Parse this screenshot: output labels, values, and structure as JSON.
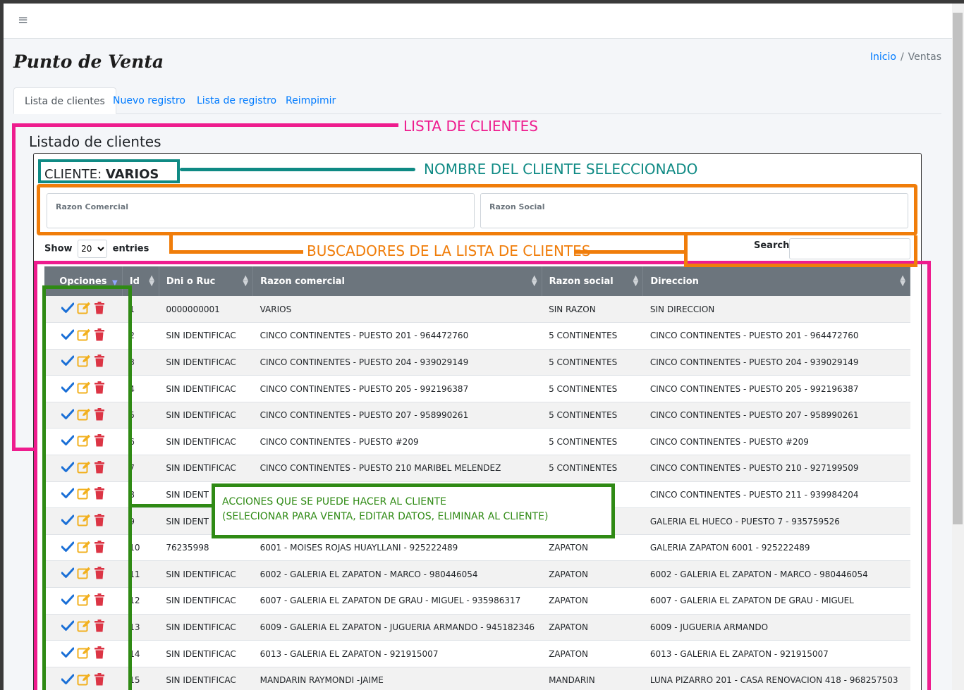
{
  "header": {
    "menu_icon": "hamburger-icon",
    "menu_glyph": "≡"
  },
  "page": {
    "title": "Punto de Venta"
  },
  "breadcrumb": {
    "home": "Inicio",
    "separator": "/",
    "current": "Ventas"
  },
  "tabs": [
    {
      "label": "Lista de clientes"
    },
    {
      "label": "Nuevo registro"
    },
    {
      "label": "Lista de registro"
    },
    {
      "label": "Reimpimir"
    }
  ],
  "section": {
    "title": "Listado de clientes"
  },
  "client": {
    "prefix": "CLIENTE:",
    "name": "VARIOS"
  },
  "filters": {
    "razon_comercial": "Razon Comercial",
    "razon_social": "Razon Social"
  },
  "length": {
    "show": "Show",
    "value": "20",
    "entries": "entries"
  },
  "search": {
    "label": "Search:"
  },
  "table": {
    "headers": [
      "Opciones",
      "Id",
      "Dni o Ruc",
      "Razon comercial",
      "Razon social",
      "Direccion"
    ],
    "rows": [
      [
        "1",
        "0000000001",
        "VARIOS",
        "SIN RAZON",
        "SIN DIRECCION"
      ],
      [
        "2",
        "SIN IDENTIFICAC",
        "CINCO CONTINENTES - PUESTO 201 - 964472760",
        "5 CONTINENTES",
        "CINCO CONTINENTES - PUESTO 201 - 964472760"
      ],
      [
        "3",
        "SIN IDENTIFICAC",
        "CINCO CONTINENTES - PUESTO 204 - 939029149",
        "5 CONTINENTES",
        "CINCO CONTINENTES - PUESTO 204 - 939029149"
      ],
      [
        "4",
        "SIN IDENTIFICAC",
        "CINCO CONTINENTES - PUESTO 205 - 992196387",
        "5 CONTINENTES",
        "CINCO CONTINENTES - PUESTO 205 - 992196387"
      ],
      [
        "5",
        "SIN IDENTIFICAC",
        "CINCO CONTINENTES - PUESTO 207 - 958990261",
        "5 CONTINENTES",
        "CINCO CONTINENTES - PUESTO 207 - 958990261"
      ],
      [
        "6",
        "SIN IDENTIFICAC",
        "CINCO CONTINENTES - PUESTO #209",
        "5 CONTINENTES",
        "CINCO CONTINENTES - PUESTO #209"
      ],
      [
        "7",
        "SIN IDENTIFICAC",
        "CINCO CONTINENTES - PUESTO 210 MARIBEL MELENDEZ",
        "5 CONTINENTES",
        "CINCO CONTINENTES - PUESTO 210 - 927199509"
      ],
      [
        "8",
        "SIN IDENT",
        "",
        "",
        "CINCO CONTINENTES - PUESTO 211 - 939984204"
      ],
      [
        "9",
        "SIN IDENT",
        "",
        "",
        "GALERIA EL HUECO - PUESTO 7 - 935759526"
      ],
      [
        "10",
        "76235998",
        "6001 - MOISES ROJAS HUAYLLANI - 925222489",
        "ZAPATON",
        "GALERIA ZAPATON 6001 - 925222489"
      ],
      [
        "11",
        "SIN IDENTIFICAC",
        "6002 - GALERIA EL ZAPATON - MARCO - 980446054",
        "ZAPATON",
        "6002 - GALERIA EL ZAPATON - MARCO - 980446054"
      ],
      [
        "12",
        "SIN IDENTIFICAC",
        "6007 - GALERIA EL ZAPATON DE GRAU - MIGUEL - 935986317",
        "ZAPATON",
        "6007 - GALERIA EL ZAPATON DE GRAU - MIGUEL"
      ],
      [
        "13",
        "SIN IDENTIFICAC",
        "6009 - GALERIA EL ZAPATON - JUGUERIA ARMANDO - 945182346",
        "ZAPATON",
        "6009 - JUGUERIA ARMANDO"
      ],
      [
        "14",
        "SIN IDENTIFICAC",
        "6013 - GALERIA EL ZAPATON - 921915007",
        "ZAPATON",
        "6013 - GALERIA EL ZAPATON - 921915007"
      ],
      [
        "15",
        "SIN IDENTIFICAC",
        "MANDARIN RAYMONDI -JAIME",
        "MANDARIN",
        "LUNA PIZARRO 201 - CASA RENOVACION 418 - 968257503"
      ]
    ],
    "row_icons": [
      "check-icon",
      "edit-icon",
      "trash-icon"
    ]
  },
  "annotations": {
    "lista": "LISTA DE CLIENTES",
    "nombre": "NOMBRE DEL CLIENTE SELECCIONADO",
    "buscadores": "BUSCADORES DE LA LISTA DE CLIENTES",
    "acciones_1": "ACCIONES QUE SE PUEDE HACER AL CLIENTE",
    "acciones_2": "(SELECIONAR PARA VENTA, EDITAR DATOS, ELIMINAR AL CLIENTE)"
  },
  "colors": {
    "pink": "#ee1c8e",
    "teal": "#0f8a84",
    "orange": "#f07d0a",
    "green": "#2f8a14",
    "check": "#1a6fd6",
    "edit": "#f2b01e",
    "trash": "#dc3545",
    "link": "#007bff",
    "header_bg": "#6c757d"
  }
}
